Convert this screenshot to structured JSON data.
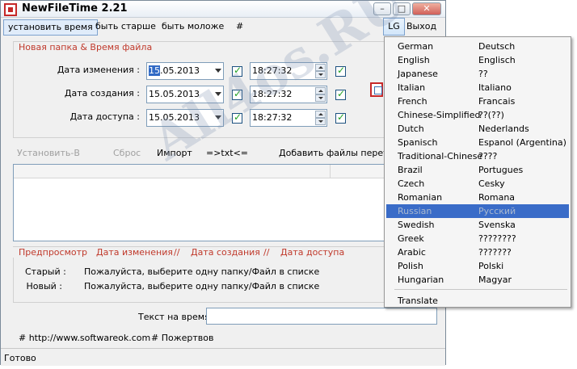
{
  "window": {
    "title": "NewFileTime 2.21"
  },
  "menu": {
    "items": [
      "установить время",
      "быть старше",
      "быть моложе",
      "#"
    ],
    "lg_label": "LG",
    "exit_label": "Выход"
  },
  "group": {
    "title": "Новая папка & Время файла",
    "rows": [
      {
        "label": "Дата изменения :",
        "date_selected": "15",
        "date_rest": ".05.2013",
        "time": "18:27:32"
      },
      {
        "label": "Дата создания :",
        "date_selected": "",
        "date_rest": "15.05.2013",
        "time": "18:27:32"
      },
      {
        "label": "Дата доступа :",
        "date_selected": "",
        "date_rest": "15.05.2013",
        "time": "18:27:32"
      }
    ]
  },
  "toolbar": {
    "set_to": "Установить-В",
    "reset": "Сброс",
    "import": "Импорт",
    "txt": "=>txt<=",
    "add_files": "Добавить файлы перетас"
  },
  "preview": {
    "label": "Предпросмотр",
    "sep": "//",
    "modified": "Дата изменения",
    "created": "Дата создания",
    "accessed": "Дата доступа",
    "old_label": "Старый :",
    "new_label": "Новый :",
    "old_value": "Пожалуйста, выберите одну папку/Файл в списке",
    "new_value": "Пожалуйста, выберите одну папку/Файл в списке"
  },
  "time_text_label": "Текст на время",
  "footer": {
    "website": "# http://www.softwareok.com",
    "donate": "# Пожертвов"
  },
  "status": "Готово",
  "languages": [
    {
      "en": "German",
      "native": "Deutsch"
    },
    {
      "en": "English",
      "native": "Englisch"
    },
    {
      "en": "Japanese",
      "native": "??"
    },
    {
      "en": "Italian",
      "native": "Italiano"
    },
    {
      "en": "French",
      "native": "Francais"
    },
    {
      "en": "Chinese-Simplified",
      "native": "??(??)"
    },
    {
      "en": "Dutch",
      "native": "Nederlands"
    },
    {
      "en": "Spanisch",
      "native": "Espanol (Argentina)"
    },
    {
      "en": "Traditional-Chinese",
      "native": "????"
    },
    {
      "en": "Brazil",
      "native": "Portugues"
    },
    {
      "en": "Czech",
      "native": "Cesky"
    },
    {
      "en": "Romanian",
      "native": "Romana"
    },
    {
      "en": "Russian",
      "native": "Русский"
    },
    {
      "en": "Swedish",
      "native": "Svenska"
    },
    {
      "en": "Greek",
      "native": "????????"
    },
    {
      "en": "Arabic",
      "native": "???????"
    },
    {
      "en": "Polish",
      "native": "Polski"
    },
    {
      "en": "Hungarian",
      "native": "Magyar"
    }
  ],
  "translate_label": "Translate",
  "selected_language_index": 12,
  "watermark": "All4os.RU"
}
